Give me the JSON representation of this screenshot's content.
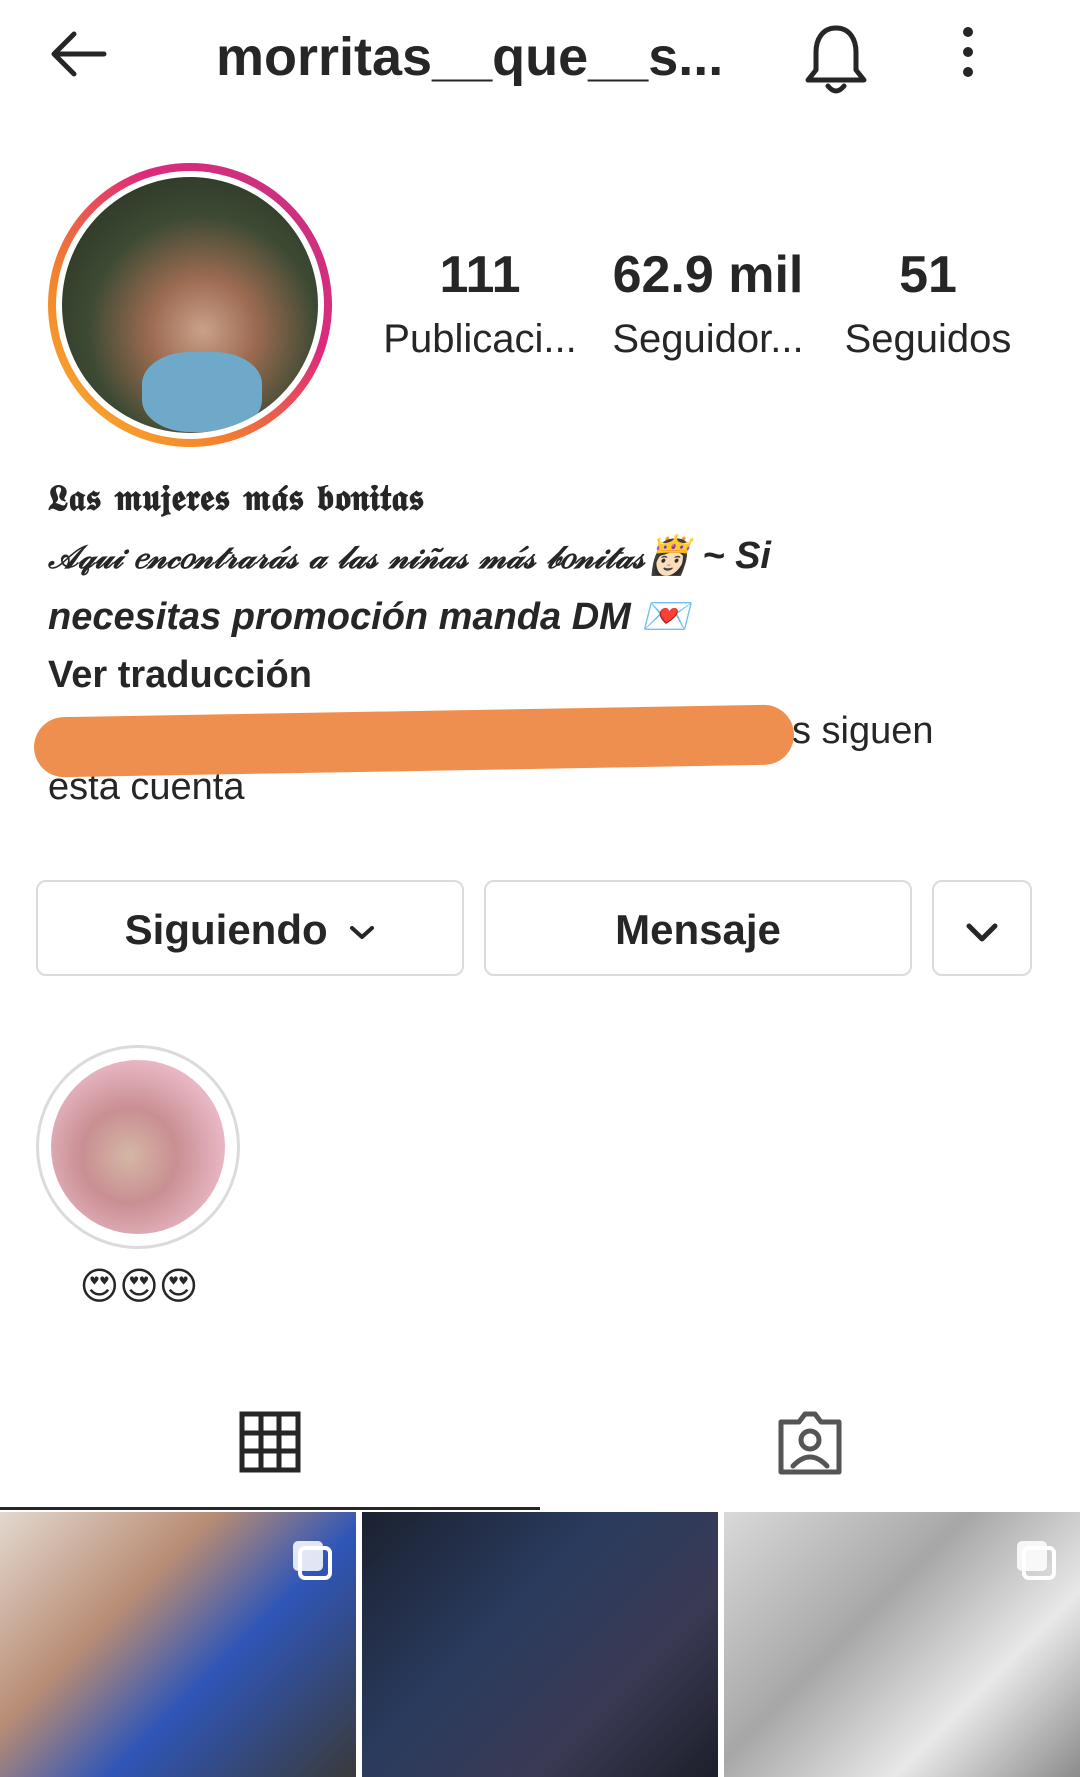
{
  "header": {
    "username": "morritas__que__s...",
    "back_icon": "arrow-left-icon",
    "bell_icon": "bell-icon",
    "more_icon": "more-vertical-icon"
  },
  "profile": {
    "stats": [
      {
        "value": "111",
        "label": "Publicaci..."
      },
      {
        "value": "62.9 mil",
        "label": "Seguidor..."
      },
      {
        "value": "51",
        "label": "Seguidos"
      }
    ],
    "bio_name": "𝕷𝖆𝖘 𝖒𝖚𝖏𝖊𝖗𝖊𝖘 𝖒𝖆́𝖘 𝖇𝖔𝖓𝖎𝖙𝖆𝖘",
    "bio_line1_fancy": "𝒜𝓆𝓊𝒾 𝑒𝓃𝒸𝑜𝓃𝓉𝓇𝒶𝓇𝒶́𝓈 𝒶 𝓁𝒶𝓈 𝓃𝒾𝓃̃𝒶𝓈 𝓂𝒶́𝓈 𝒷𝑜𝓃𝒾𝓉𝒶𝓈",
    "bio_line1_emoji": "👸🏻",
    "bio_line1_tail": " ~ Si",
    "bio_line2": "necesitas promoción manda DM",
    "bio_line2_emoji": "💌",
    "translate": "Ver traducción",
    "followed_by": "s siguen",
    "followed_by_tail": "esta cuenta"
  },
  "actions": {
    "following_label": "Siguiendo",
    "message_label": "Mensaje"
  },
  "highlights": [
    {
      "label": "😍😍😍"
    }
  ],
  "tabs": [
    {
      "icon": "grid-icon",
      "active": true
    },
    {
      "icon": "tagged-user-icon",
      "active": false
    }
  ],
  "colors": {
    "text": "#262626",
    "border": "#dbdbdb",
    "redaction": "#ef8f4f",
    "story_ring_start": "#f7b733",
    "story_ring_end": "#c13584"
  }
}
